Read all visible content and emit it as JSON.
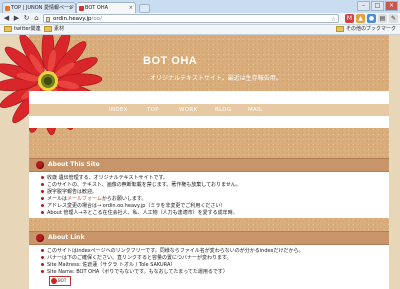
{
  "browser": {
    "tabs": [
      {
        "label": "TOP | JUNON 愛情報ページ"
      },
      {
        "label": "BOT OHA"
      }
    ],
    "address": {
      "host": "ordin.heavy.jp",
      "path": "/oo/"
    },
    "bookmarks": [
      {
        "label": "twitter関連"
      },
      {
        "label": "素材"
      }
    ],
    "other_bookmarks": "その他のブックマーク"
  },
  "site": {
    "title": "BOT OHA",
    "subtitle": "オリジナルテキストサイト。最近は生存報告用。",
    "menu": [
      "INDEX",
      "TOP",
      "WORK",
      "BLOG",
      "MAIL"
    ]
  },
  "about_site": {
    "heading": "About This Site",
    "items": [
      {
        "text": "收歳 遺伝管理する、オリジナルテキストサイトです。"
      },
      {
        "text": "このサイトの、テキスト、画像の無断転載を禁じます。著作権も放棄しておりません。"
      },
      {
        "text": "誤字脱字報告は歓迎。"
      },
      {
        "pre": "メールは",
        "link": "メールフォーム",
        "post": "からお願いします。"
      },
      {
        "text": "アドレス変更の場合は→ ordin.oo.heavy.jp（ミラを非変更でご利用ください）"
      },
      {
        "text": "About 管理人→ネとこる在住会社人、私、人工物（人力も逢適市）を愛する成年時。"
      }
    ]
  },
  "about_link": {
    "heading": "About Link",
    "items": [
      {
        "text": "このサイトはindexページへのリンクフリーです。同様ならファイル名が変わらないのが分かるindexだけだから。"
      },
      {
        "text": "バナーは下のご確保ください。直リンクすると容量の置につバナーが変わります。"
      },
      {
        "text": "Site Maitress: 佐倉蓮（サクラ トオル / Tole SAKURA）"
      },
      {
        "text": "Site Name: BOT OHA（ボりでもないです。もなおしてたまってた運用るです）"
      }
    ],
    "banner_text": "BOT"
  },
  "colors": {
    "accent": "#b31c1c",
    "cork": "#d9ae7c",
    "heading_bar": "#c8956a"
  }
}
